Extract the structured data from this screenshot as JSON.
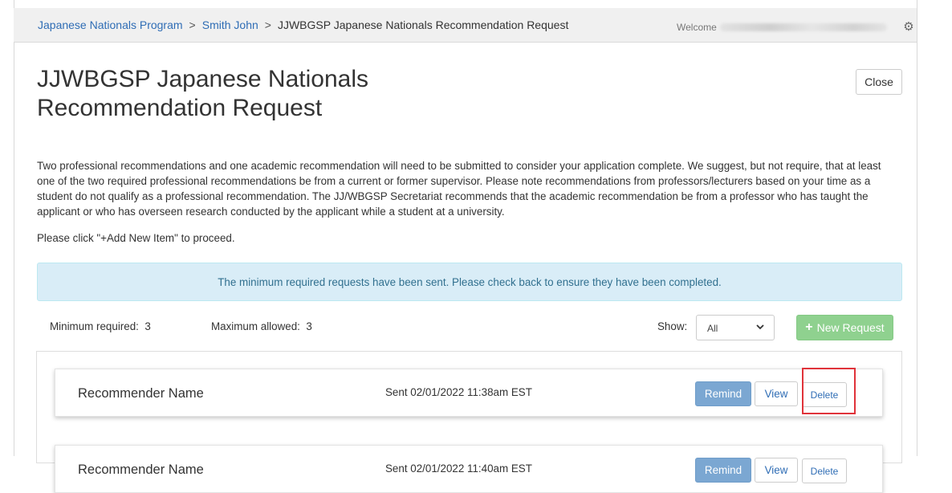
{
  "breadcrumb": {
    "items": [
      "Japanese Nationals Program",
      "Smith John"
    ],
    "separator": ">",
    "current": "JJWBGSP Japanese Nationals Recommendation Request"
  },
  "header": {
    "welcome_label": "Welcome"
  },
  "page": {
    "title_line1": "JJWBGSP Japanese Nationals",
    "title_line2": "Recommendation Request",
    "close_label": "Close",
    "intro": "Two professional recommendations and one academic recommendation will need to be submitted to consider your application complete. We suggest, but not require, that at least one of the two required professional recommendations be from a current or former supervisor. Please note recommendations from professors/lecturers based on your time as a student do not qualify as a professional recommendation. The JJ/WBGSP Secretariat recommends that the academic recommendation be from a professor who has taught the applicant or who has overseen research conducted by the applicant while a student at a university.",
    "instruction": "Please click \"+Add New Item\" to proceed."
  },
  "alert": {
    "text": "The minimum required requests have been sent. Please check back to ensure they have been completed."
  },
  "stats": {
    "minimum_label": "Minimum required:",
    "minimum_value": "3",
    "maximum_label": "Maximum allowed:",
    "maximum_value": "3"
  },
  "filter": {
    "show_label": "Show:",
    "selected": "All"
  },
  "new_request": {
    "icon": "plus-icon",
    "label": "New Request"
  },
  "requests": [
    {
      "name": "Recommender Name",
      "sent": "Sent 02/01/2022 11:38am EST",
      "remind_label": "Remind",
      "view_label": "View",
      "delete_label": "Delete"
    },
    {
      "name": "Recommender Name",
      "sent": "Sent 02/01/2022 11:40am EST",
      "remind_label": "Remind",
      "view_label": "View",
      "delete_label": "Delete"
    }
  ],
  "colors": {
    "link": "#2f6db5",
    "alert_bg": "#d9edf7",
    "alert_text": "#31708f",
    "success": "#8fd18f",
    "primary": "#7ba7d2",
    "highlight": "#e0333a"
  }
}
